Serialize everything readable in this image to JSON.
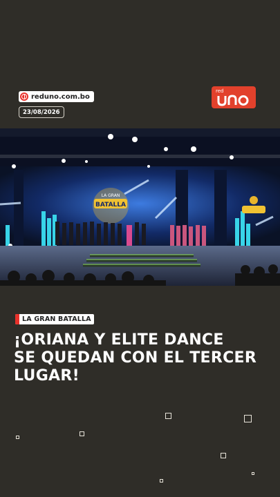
{
  "header": {
    "site": "reduno.com.bo",
    "date": "23/08/2026",
    "logo_top": "red",
    "logo_main": "UNO"
  },
  "photo": {
    "description_icon": "stage-photo",
    "screen_text_line1": "LA GRAN",
    "screen_text_line2": "BATALLA"
  },
  "article": {
    "category": "LA GRAN BATALLA",
    "headline_lines": [
      "¡ORIANA Y ELITE DANCE",
      "SE QUEDAN CON EL TERCER",
      "LUGAR!"
    ]
  },
  "colors": {
    "background": "#2f2d28",
    "accent": "#e8312a",
    "logo_bg": "#e2412c"
  }
}
